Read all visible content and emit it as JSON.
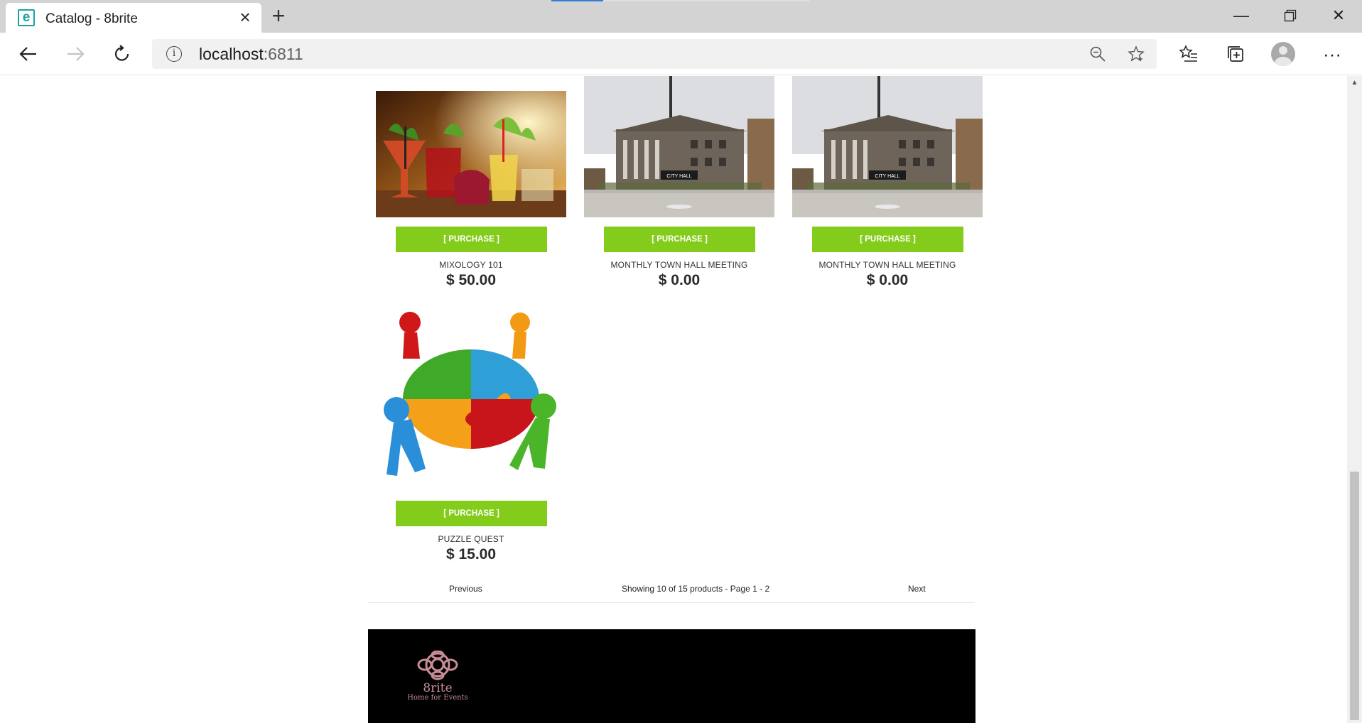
{
  "browser": {
    "tab_title": "Catalog - 8brite",
    "url_host": "localhost",
    "url_port": ":6811"
  },
  "products": [
    {
      "name": "MIXOLOGY 101",
      "price": "$ 50.00",
      "button": "[ PURCHASE ]",
      "image": "cocktails"
    },
    {
      "name": "MONTHLY TOWN HALL MEETING",
      "price": "$ 0.00",
      "button": "[ PURCHASE ]",
      "image": "city-hall"
    },
    {
      "name": "MONTHLY TOWN HALL MEETING",
      "price": "$ 0.00",
      "button": "[ PURCHASE ]",
      "image": "city-hall"
    },
    {
      "name": "PUZZLE QUEST",
      "price": "$ 15.00",
      "button": "[ PURCHASE ]",
      "image": "puzzle-figures"
    }
  ],
  "pager": {
    "previous": "Previous",
    "info": "Showing 10 of 15 products - Page 1 - 2",
    "next": "Next"
  },
  "footer": {
    "logo_name": "8rite",
    "logo_tagline": "Home for Events"
  },
  "colors": {
    "purchase_button": "#84cc1c",
    "footer_bg": "#000000",
    "logo": "#c98c96"
  }
}
